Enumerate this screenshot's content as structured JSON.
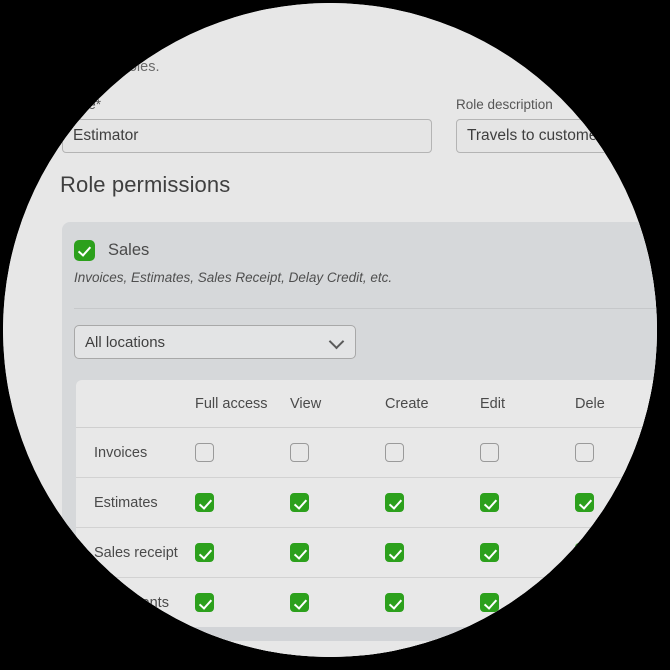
{
  "form": {
    "lead_text": "it custom roles.",
    "role_name_label": "name*",
    "role_name_value": "Estimator",
    "role_description_label": "Role description",
    "role_description_value": "Travels to customers"
  },
  "permissions_section": {
    "heading": "Role permissions",
    "card": {
      "title": "Sales",
      "checked": true,
      "subtitle": "Invoices, Estimates, Sales Receipt, Delay Credit, etc."
    },
    "locations_select": {
      "value": "All locations",
      "chevron": "chevron-down-icon"
    },
    "table": {
      "columns": [
        "",
        "Full access",
        "View",
        "Create",
        "Edit",
        "Dele"
      ],
      "rows": [
        {
          "name": "Invoices",
          "values": [
            false,
            false,
            false,
            false,
            false
          ]
        },
        {
          "name": "Estimates",
          "values": [
            true,
            true,
            true,
            true,
            true
          ]
        },
        {
          "name": "Sales receipt",
          "values": [
            true,
            true,
            true,
            true,
            true
          ]
        },
        {
          "name": "e payments",
          "values": [
            true,
            true,
            true,
            true,
            true
          ]
        }
      ]
    }
  },
  "colors": {
    "accent_green": "#2ca01c",
    "page_background": "#e7e7e7",
    "card_background": "#d6d8da",
    "table_background": "#e8e8e8"
  }
}
